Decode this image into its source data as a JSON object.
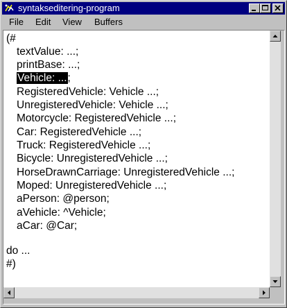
{
  "window": {
    "title": "syntakseditering-program"
  },
  "menu": {
    "items": [
      "File",
      "Edit",
      "View",
      "Buffers"
    ]
  },
  "editor": {
    "lines": [
      "(#",
      "textValue: ...;",
      "printBase: ...;",
      "Vehicle: ...;",
      "RegisteredVehicle: Vehicle ...;",
      "UnregisteredVehicle: Vehicle ...;",
      "Motorcycle: RegisteredVehicle ...;",
      "Car: RegisteredVehicle ...;",
      "Truck: RegisteredVehicle ...;",
      "Bicycle: UnregisteredVehicle ...;",
      "HorseDrawnCarriage: UnregisteredVehicle ...;",
      "Moped: UnregisteredVehicle ...;",
      "aPerson: @person;",
      "aVehicle: ^Vehicle;",
      "aCar: @Car;",
      "do ...",
      "#)"
    ],
    "highlighted": {
      "word": "Vehicle: ...",
      "rest": ";"
    }
  },
  "colors": {
    "titlebar": "#000080",
    "selection": "#000000"
  }
}
